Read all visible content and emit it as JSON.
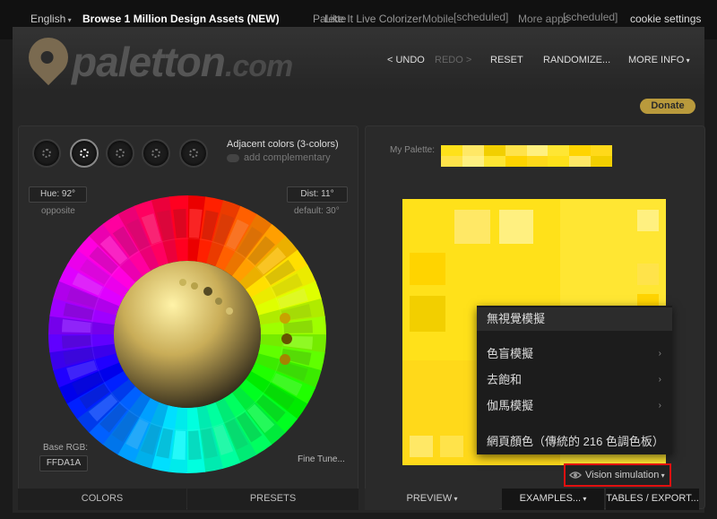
{
  "topbar": {
    "language": "English",
    "browse": "Browse 1 Million Design Assets (NEW)",
    "overlap_a": "Palette",
    "overlap_b": "Like It Live Colorizer",
    "mobile": "Mobile",
    "mobile_badge": "[scheduled]",
    "more_apps": "More apps",
    "more_apps_badge": "[scheduled]",
    "cookie": "cookie settings"
  },
  "header": {
    "logo": "paletton",
    "logo_tld": ".com",
    "undo": "< UNDO",
    "redo": "REDO >",
    "reset": "RESET",
    "randomize": "RANDOMIZE...",
    "more_info": "MORE INFO"
  },
  "donate": "Donate",
  "wheel": {
    "scheme_name": "Adjacent colors (3-colors)",
    "add_complementary": "add complementary",
    "hue": "Hue: 92°",
    "opposite": "opposite",
    "dist": "Dist: 11°",
    "default_dist": "default: 30°",
    "base_rgb_label": "Base RGB:",
    "base_rgb": "FFDA1A",
    "fine_tune": "Fine Tune..."
  },
  "palette": {
    "label": "My Palette:",
    "colors": [
      "#ffe11a",
      "#ffe34a",
      "#ffd400",
      "#ffe866",
      "#fff080",
      "#ffd91a",
      "#f2cf00",
      "#ffe633"
    ]
  },
  "vision_menu": {
    "items": [
      {
        "label": "無視覺模擬",
        "submenu": false,
        "selected": true
      },
      {
        "label": "色盲模擬",
        "submenu": true
      },
      {
        "label": "去飽和",
        "submenu": true
      },
      {
        "label": "伽馬模擬",
        "submenu": true
      },
      {
        "label": "網頁顏色（傳統的 216 色調色板）",
        "submenu": false
      }
    ]
  },
  "vision_button": "Vision simulation",
  "tabs": {
    "colors": "COLORS",
    "presets": "PRESETS",
    "preview": "PREVIEW",
    "examples": "EXAMPLES...",
    "tables": "TABLES / EXPORT..."
  },
  "accent_colors": {
    "donate": "#b99a3c",
    "highlight_border": "#e21010",
    "base": "#ffda1a"
  }
}
